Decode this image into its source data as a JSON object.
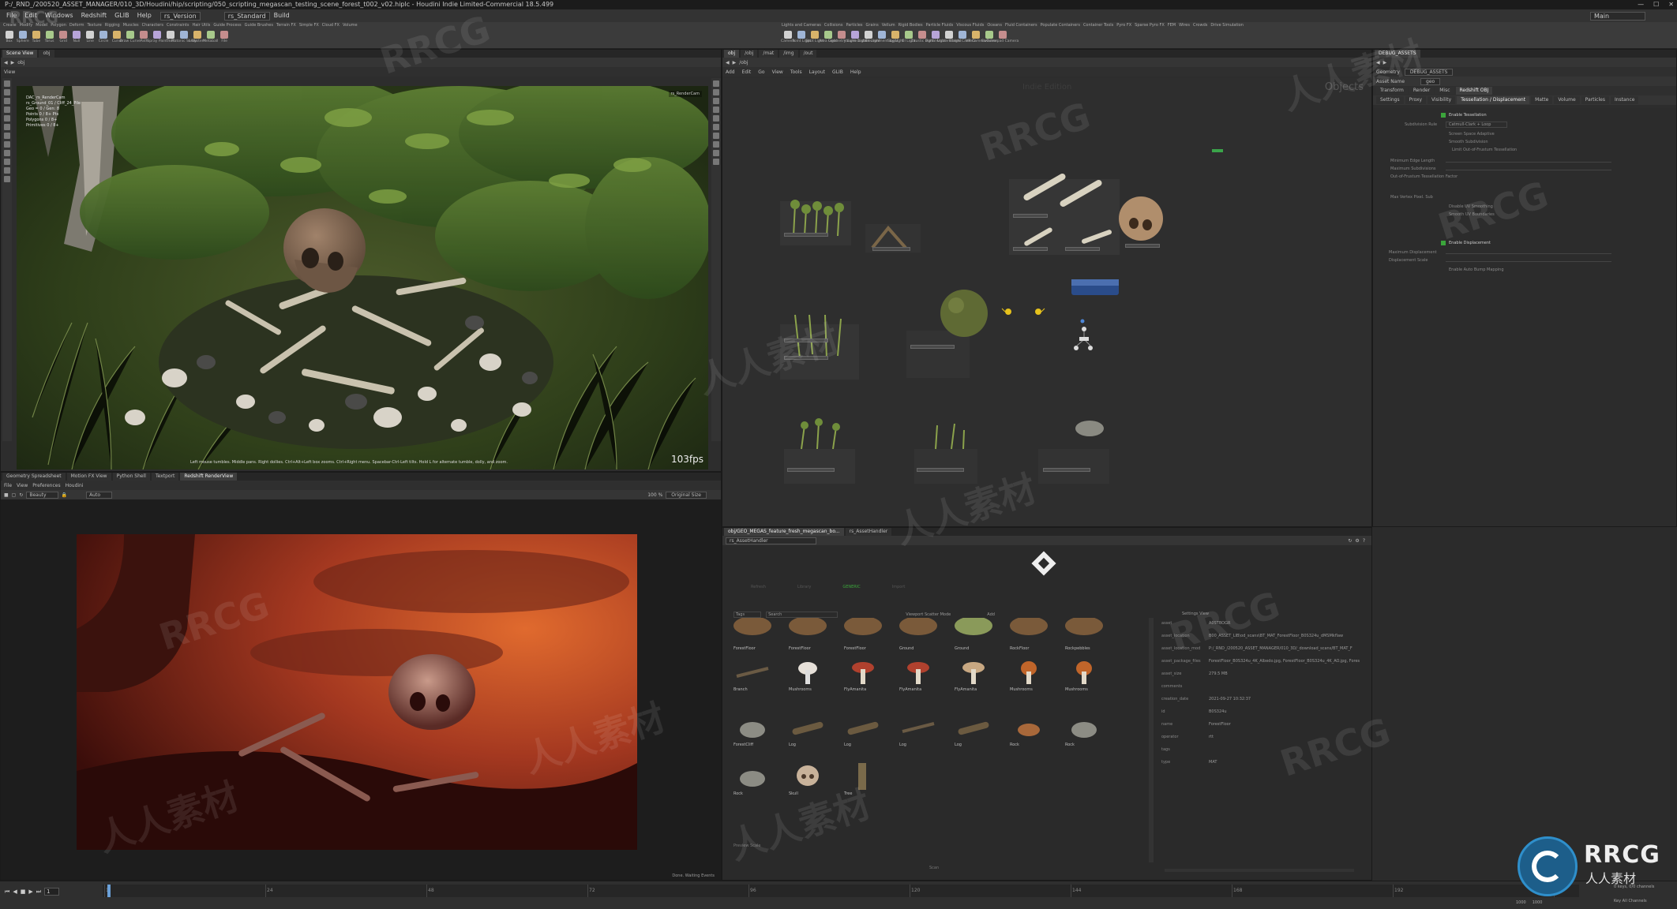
{
  "window": {
    "title": "P:/_RND_/200520_ASSET_MANAGER/010_3D/Houdini/hip/scripting/050_scripting_megascan_testing_scene_forest_t002_v02.hiplc - Houdini Indie Limited-Commercial 18.5.499",
    "logo_text": "RRCG",
    "minimize": "—",
    "maximize": "☐",
    "close": "✕"
  },
  "menubar": {
    "items": [
      "File",
      "Edit",
      "Windows",
      "Redshift",
      "GLIB",
      "Help"
    ],
    "desktop_field": "rs_Version",
    "build_field": "rs_Standard",
    "main_field": "Main",
    "build_label": "Build"
  },
  "shelf": {
    "left_tabs": [
      "Create",
      "Modify",
      "Model",
      "Polygon",
      "Deform",
      "Texture",
      "Rigging",
      "Muscles",
      "Characters",
      "Constraints",
      "Hair Utils",
      "Guide Process",
      "Guide Brushes",
      "Terrain FX",
      "Simple FX",
      "Cloud FX",
      "Volume"
    ],
    "left_tools": [
      "Box",
      "Sphere",
      "Tube",
      "Torus",
      "Grid",
      "Null",
      "Line",
      "Circle",
      "Curve",
      "Draw Curve",
      "Path",
      "Spray Paint",
      "Text",
      "Platonic Solids",
      "L-System",
      "Metaball",
      "File"
    ],
    "right_tabs": [
      "Lights and Cameras",
      "Collisions",
      "Particles",
      "Grains",
      "Vellum",
      "Rigid Bodies",
      "Particle Fluids",
      "Viscous Fluids",
      "Oceans",
      "Fluid Containers",
      "Populate Containers",
      "Container Tools",
      "Pyro FX",
      "Sparse Pyro FX",
      "FEM",
      "Wires",
      "Crowds",
      "Drive Simulation"
    ],
    "right_tools": [
      "Camera",
      "Point Light",
      "Spot Light",
      "Area Light",
      "Geometry Light",
      "Volume Light",
      "Distant Light",
      "Environment Light",
      "Sky Light",
      "GI Light",
      "Caustic Light",
      "Portal Light",
      "Ambient Light",
      "Stereo Camera",
      "VR Camera",
      "Switcher",
      "Gamepad Camera"
    ]
  },
  "scene_view": {
    "pane_tabs": [
      "Scene View",
      "obj"
    ],
    "viewer_label": "View",
    "cam_label": "rs_RenderCam",
    "fps": "103fps",
    "overlay_lines": [
      "DAC_rs_RenderCam",
      "rs_Ground_01 / Cliff_24_Pile",
      "Geo = 0 / Gen: 8",
      "Points 0 / 8+ Pts",
      "Polygons 0 / 8+",
      "Primitives 0 / 8+"
    ],
    "status_hint": "Left mouse tumbles. Middle pans. Right dollies. Ctrl+Alt+Left box zooms. Ctrl+Right menu. Spacebar-Ctrl-Left tilts. Hold L for alternate tumble, dolly, and zoom."
  },
  "bottom_left": {
    "pane_tabs": [
      "Geometry Spreadsheet",
      "Motion FX View",
      "Python Shell",
      "Textport",
      "Redshift RenderView"
    ],
    "menu": [
      "File",
      "View",
      "Preferences",
      "Houdini"
    ],
    "aov": "Beauty",
    "auto": "Auto",
    "zoom": "100 %",
    "size_mode": "Original Size",
    "status": "Done. Waiting Events"
  },
  "network": {
    "tabs": [
      "obj",
      "/obj"
    ],
    "path": [
      "/obj",
      "/mat",
      "/img",
      "/out"
    ],
    "menu": [
      "Add",
      "Edit",
      "Go",
      "View",
      "Tools",
      "Layout",
      "GLIB",
      "Help"
    ],
    "context_label": "Objects",
    "watermark": "Indie Edition"
  },
  "params": {
    "tabs": [
      "DEBUG_ASSETS"
    ],
    "node_type": "Geometry",
    "node_name": "DEBUG_ASSETS",
    "asset_name_label": "Asset Name",
    "asset_name_value": "geo",
    "top_tabs": [
      "Transform",
      "Render",
      "Misc",
      "Redshift OBJ"
    ],
    "sub_tabs": [
      "Settings",
      "Proxy",
      "Visibility",
      "Tessellation / Displacement",
      "Matte",
      "Volume",
      "Particles",
      "Instance"
    ],
    "enable_tess": "Enable Tessellation",
    "subdivision_rule": "Subdivision Rule",
    "subdivision_value": "Catmull-Clark + Loop",
    "screen_space": "Screen Space Adaptive",
    "smooth_subdiv": "Smooth Subdivision",
    "limit_surface": "Limit Out-of-Frustum Tessellation",
    "min_edge": "Minimum Edge Length",
    "max_subdiv": "Maximum Subdivisions",
    "frustum_factor": "Out-of-Frustum Tessellation Factor",
    "uv_smoothing": "Max Vertex Pixel. Sub",
    "disable_uv": "Disable UV Smoothing",
    "smooth_boundary": "Smooth UV Boundaries",
    "enable_disp": "Enable Displacement",
    "max_disp": "Maximum Displacement",
    "disp_scale": "Displacement Scale",
    "auto_bump": "Enable Auto Bump Mapping"
  },
  "asset_handler": {
    "tabs": [
      "obj/GEO_MEGAS_feature_fresh_megascan_bo...",
      "rs_AssetHandler"
    ],
    "node_field": "rs_AssetHandler",
    "buttons": [
      "Refresh",
      "Library",
      "Import"
    ],
    "status_label": "GENERIC",
    "filter_label": "Tags",
    "search_label": "Search",
    "viewport_mode": "Viewport Scatter Mode",
    "add_label": "Add",
    "view_mode": "Settings View",
    "thumbnails": [
      {
        "label": "ForestFloor",
        "kind": "ground"
      },
      {
        "label": "ForestFloor",
        "kind": "ground"
      },
      {
        "label": "ForestFloor",
        "kind": "ground"
      },
      {
        "label": "Ground",
        "kind": "ground"
      },
      {
        "label": "Ground",
        "kind": "moss"
      },
      {
        "label": "RockFloor",
        "kind": "ground"
      },
      {
        "label": "Rockpebbles",
        "kind": "ground"
      },
      {
        "label": "Branch",
        "kind": "branch"
      },
      {
        "label": "Mushrooms",
        "kind": "mush-white"
      },
      {
        "label": "FlyAmanita",
        "kind": "mush-red"
      },
      {
        "label": "FlyAmanita",
        "kind": "mush-red"
      },
      {
        "label": "FlyAmanita",
        "kind": "mush-tan"
      },
      {
        "label": "Mushrooms",
        "kind": "mush-orange"
      },
      {
        "label": "Mushrooms",
        "kind": "mush-orange"
      },
      {
        "label": "ForestCliff",
        "kind": "rock"
      },
      {
        "label": "Log",
        "kind": "log"
      },
      {
        "label": "Log",
        "kind": "log"
      },
      {
        "label": "Log",
        "kind": "branch"
      },
      {
        "label": "Log",
        "kind": "log"
      },
      {
        "label": "Rock",
        "kind": "wood"
      },
      {
        "label": "Rock",
        "kind": "rock"
      },
      {
        "label": "Rock",
        "kind": "rock"
      },
      {
        "label": "Skull",
        "kind": "skull"
      },
      {
        "label": "Tree",
        "kind": "tree"
      }
    ],
    "preview_scale": "Preview Scale",
    "scan_label": "Scan",
    "details": [
      {
        "key": "asset",
        "value": "A0STBOGR"
      },
      {
        "key": "asset_location",
        "value": "B00_ASSET_LIB\\od_scans\\BT_MAT_ForestFloor_B0S324u_dMSMkflaw"
      },
      {
        "key": "asset_location_mod",
        "value": "P:/_RND_/200520_ASSET_MANAGER/010_3D/_download_scans/BT_MAT_F"
      },
      {
        "key": "asset_package_files",
        "value": "ForestFloor_B0S324u_4K_Albedo.jpg, ForestFloor_B0S324u_4K_AO.jpg, Fores"
      },
      {
        "key": "asset_size",
        "value": "279.5 MB"
      },
      {
        "key": "comments",
        "value": ""
      },
      {
        "key": "creation_date",
        "value": "2021-09-27 10:32:37"
      },
      {
        "key": "id",
        "value": "B0S324u"
      },
      {
        "key": "name",
        "value": "ForestFloor"
      },
      {
        "key": "operator",
        "value": "rtt"
      },
      {
        "key": "tags",
        "value": ""
      },
      {
        "key": "type",
        "value": "MAT"
      }
    ]
  },
  "timeline": {
    "frame": "1",
    "ticks": [
      "1",
      "24",
      "48",
      "72",
      "96",
      "120",
      "144",
      "168",
      "192",
      "216"
    ],
    "end_frames": [
      "1000",
      "1000"
    ],
    "keys_label": "0 keys, 0/0 channels",
    "key_all": "Key All Channels"
  },
  "watermarks": [
    "RRCG",
    "人人素材",
    "RRCG",
    "人人素材",
    "RRCG",
    "人人素材",
    "RRCG",
    "人人素材",
    "RRCG",
    "人人素材",
    "RRCG",
    "人人素材"
  ],
  "brand": {
    "logo": "RRCG",
    "sub": "人人素材"
  },
  "colors": {
    "node_yellow": "#e6c21c",
    "node_blue": "#3a63c9",
    "accent_green": "#3ba53b",
    "render_red": "#c0402a"
  }
}
